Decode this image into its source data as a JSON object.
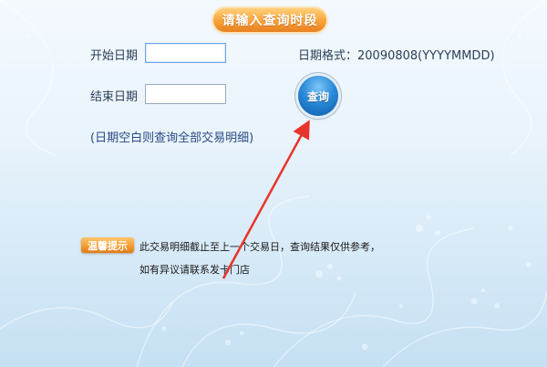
{
  "header": {
    "title": "请输入查询时段"
  },
  "form": {
    "start_label": "开始日期",
    "start_value": "",
    "end_label": "结束日期",
    "end_value": "",
    "format_hint": "日期格式：20090808(YYYYMMDD)",
    "query_label": "查询",
    "blank_note": "(日期空白则查询全部交易明细)"
  },
  "tip": {
    "badge": "温馨提示",
    "line1": "此交易明细截止至上一个交易日，查询结果仅供参考，",
    "line2": "如有异议请联系发卡门店"
  },
  "colors": {
    "accent_orange": "#f9a23a",
    "button_blue": "#2a8ad9",
    "annotation_red": "#e8342b"
  }
}
